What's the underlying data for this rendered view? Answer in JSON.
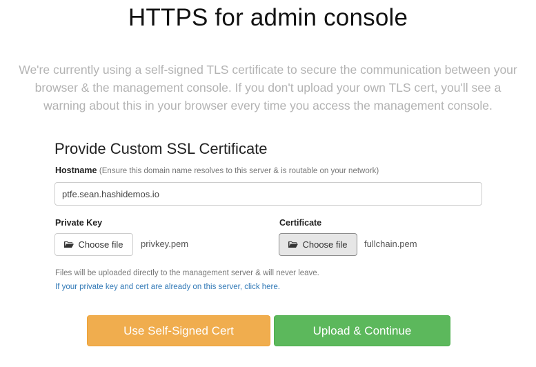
{
  "page": {
    "title": "HTTPS for admin console",
    "intro": "We're currently using a self-signed TLS certificate to secure the communication between your browser & the management console. If you don't upload your own TLS cert, you'll see a warning about this in your browser every time you access the management console."
  },
  "form": {
    "section_title": "Provide Custom SSL Certificate",
    "hostname": {
      "label": "Hostname",
      "hint": "(Ensure this domain name resolves to this server & is routable on your network)",
      "value": "ptfe.sean.hashidemos.io"
    },
    "private_key": {
      "label": "Private Key",
      "button_label": "Choose file",
      "file_name": "privkey.pem"
    },
    "certificate": {
      "label": "Certificate",
      "button_label": "Choose file",
      "file_name": "fullchain.pem"
    },
    "note": "Files will be uploaded directly to the management server & will never leave.",
    "server_link": "If your private key and cert are already on this server, click here."
  },
  "actions": {
    "self_signed_label": "Use Self-Signed Cert",
    "upload_label": "Upload & Continue"
  },
  "colors": {
    "warning": "#f0ad4e",
    "success": "#5cb85c",
    "link": "#337ab7"
  },
  "icons": {
    "file_button": "folder-open-icon"
  }
}
